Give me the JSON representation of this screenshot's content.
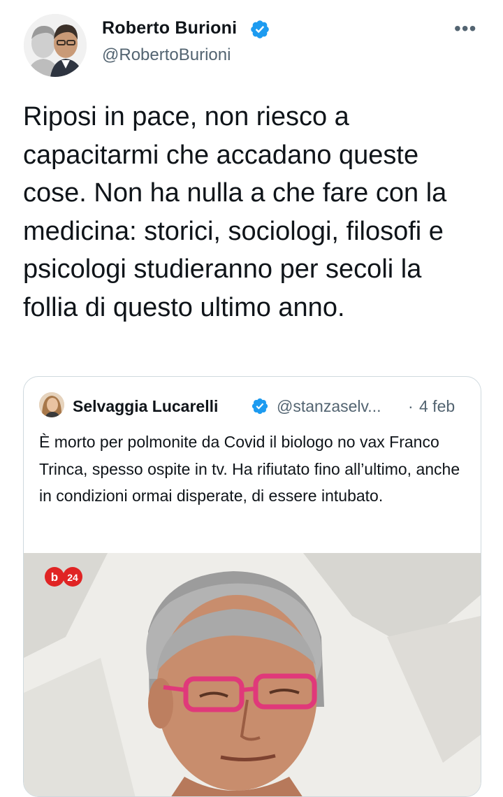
{
  "tweet": {
    "author_name": "Roberto Burioni",
    "author_handle": "@RobertoBurioni",
    "more_label": "•••",
    "text": "Riposi in pace, non riesco a capacitarmi che accadano queste cose. Non ha nulla a che fare con la medicina: storici, sociologi, filosofi e psicologi studieranno per secoli la follia di questo ultimo anno.",
    "verified_color": "#1d9bf0"
  },
  "quoted_tweet": {
    "author_name": "Selvaggia Lucarelli",
    "author_handle": "@stanzaselv...",
    "separator": "·",
    "date": "4 feb",
    "text": "È morto per polmonite da Covid il biologo no vax Franco Trinca, spesso ospite in tv. Ha rifiutato fino all’ultimo, anche in condizioni ormai disperate, di essere intubato.",
    "media_logo": "b24"
  }
}
